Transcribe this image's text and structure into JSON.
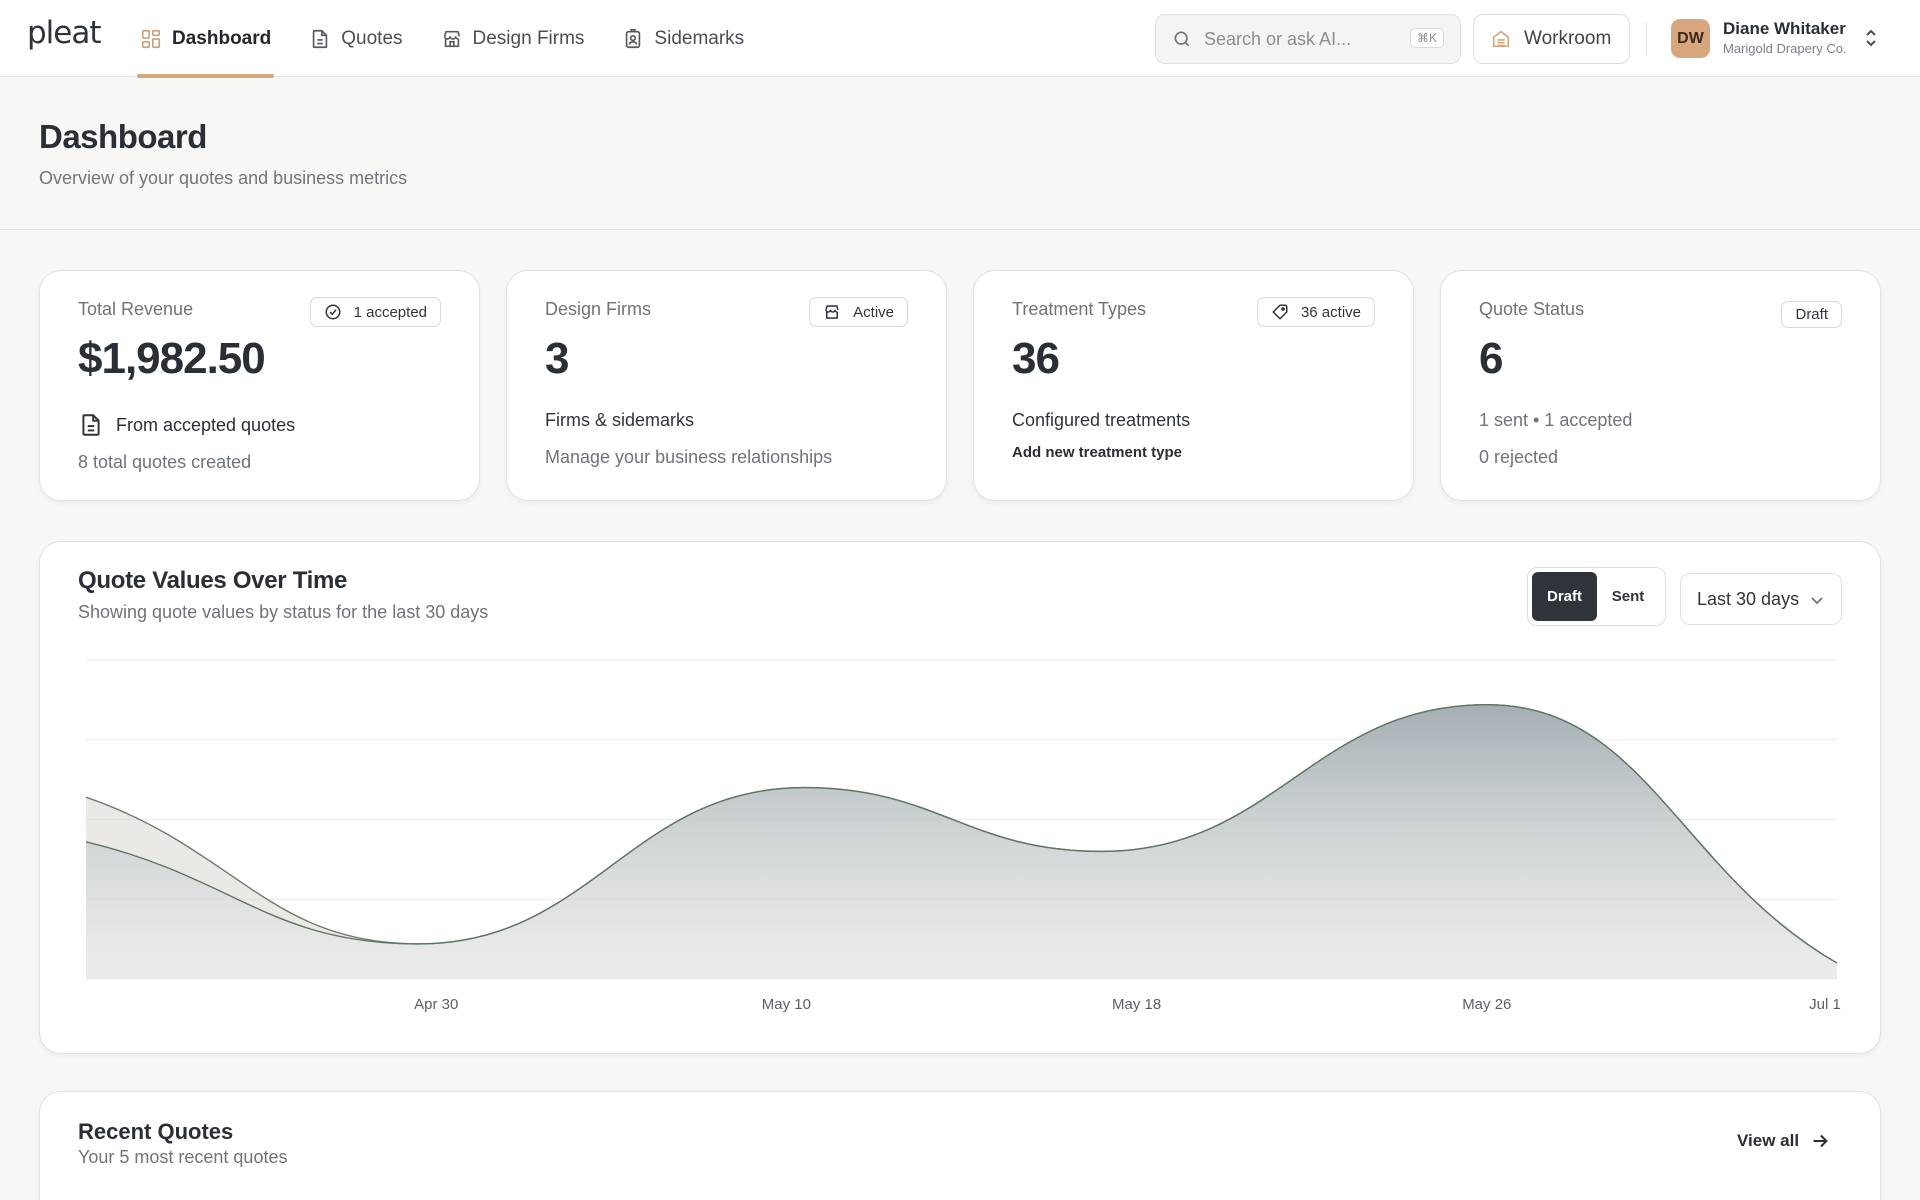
{
  "app": {
    "logo": "pleat"
  },
  "nav": {
    "items": [
      {
        "label": "Dashboard",
        "icon": "grid-icon",
        "active": true
      },
      {
        "label": "Quotes",
        "icon": "document-icon",
        "active": false
      },
      {
        "label": "Design Firms",
        "icon": "store-icon",
        "active": false
      },
      {
        "label": "Sidemarks",
        "icon": "badge-icon",
        "active": false
      }
    ]
  },
  "search": {
    "placeholder": "Search or ask AI...",
    "shortcut": "⌘K"
  },
  "workroom": {
    "label": "Workroom"
  },
  "user": {
    "initials": "DW",
    "name": "Diane Whitaker",
    "org": "Marigold Drapery Co."
  },
  "colors": {
    "accent": "#d4a77e",
    "avatar": "#d8a67c",
    "dark": "#2f343b",
    "series_line": "#5f7560"
  },
  "page": {
    "title": "Dashboard",
    "subtitle": "Overview of your quotes and business metrics"
  },
  "cards": {
    "revenue": {
      "label": "Total Revenue",
      "badge": "1 accepted",
      "value": "$1,982.50",
      "line1": "From accepted quotes",
      "line2": "8 total quotes created"
    },
    "firms": {
      "label": "Design Firms",
      "badge": "Active",
      "value": "3",
      "line1": "Firms & sidemarks",
      "line2": "Manage your business relationships"
    },
    "treatments": {
      "label": "Treatment Types",
      "badge": "36 active",
      "value": "36",
      "line1": "Configured treatments",
      "link": "Add new treatment type"
    },
    "status": {
      "label": "Quote Status",
      "badge": "Draft",
      "value": "6",
      "line1": "1 sent • 1 accepted",
      "line2": "0 rejected"
    }
  },
  "chart": {
    "title": "Quote Values Over Time",
    "subtitle": "Showing quote values by status for the last 30 days",
    "toggle": {
      "draft": "Draft",
      "sent": "Sent",
      "selected": "Draft"
    },
    "range": "Last 30 days"
  },
  "chart_data": {
    "type": "area",
    "title": "Quote Values Over Time",
    "x_ticks": [
      "Apr 30",
      "May 10",
      "May 18",
      "May 26",
      "Jul 1"
    ],
    "grid": true,
    "ylim": [
      0,
      100
    ],
    "series": [
      {
        "name": "Draft",
        "points": [
          [
            0,
            57
          ],
          [
            0.19,
            11
          ],
          [
            0.41,
            60
          ],
          [
            0.58,
            40
          ],
          [
            0.8,
            86
          ],
          [
            1.0,
            5
          ]
        ]
      },
      {
        "name": "Sent",
        "points": [
          [
            0,
            43
          ],
          [
            0.19,
            11
          ],
          [
            0.41,
            60
          ],
          [
            0.58,
            40
          ],
          [
            0.8,
            86
          ],
          [
            1.0,
            5
          ]
        ]
      }
    ]
  },
  "recent": {
    "title": "Recent Quotes",
    "subtitle": "Your 5 most recent quotes",
    "view_all": "View all"
  }
}
